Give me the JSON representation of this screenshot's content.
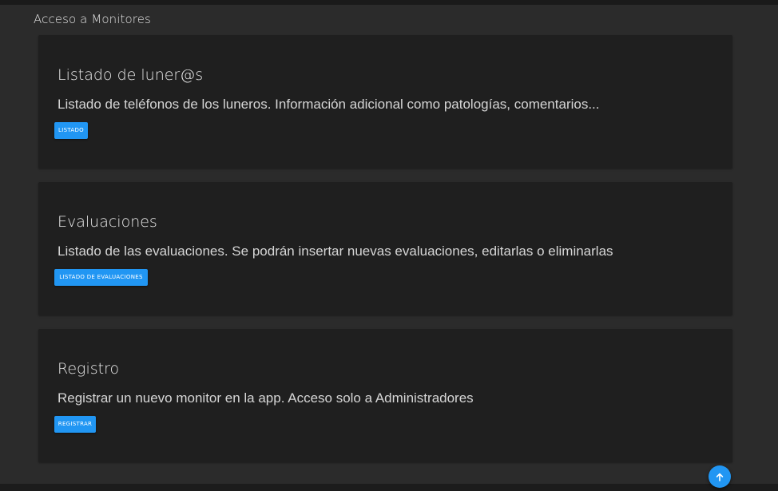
{
  "page": {
    "title": "Acceso a Monitores"
  },
  "cards": [
    {
      "title": "Listado de luner@s",
      "description": "Listado de teléfonos de los luneros. Información adicional como patologías, comentarios...",
      "button_label": "LISTADO"
    },
    {
      "title": "Evaluaciones",
      "description": "Listado de las evaluaciones. Se podrán insertar nuevas evaluaciones, editarlas o eliminarlas",
      "button_label": "LISTADO DE EVALUACIONES"
    },
    {
      "title": "Registro",
      "description": "Registrar un nuevo monitor en la app. Acceso solo a Administradores",
      "button_label": "REGISTRAR"
    }
  ],
  "fab": {
    "icon": "arrow-up-icon"
  },
  "colors": {
    "page_background": "#2b2b2b",
    "card_background": "#1f1f1f",
    "accent": "#2196f3",
    "text": "#e8e8e8"
  }
}
